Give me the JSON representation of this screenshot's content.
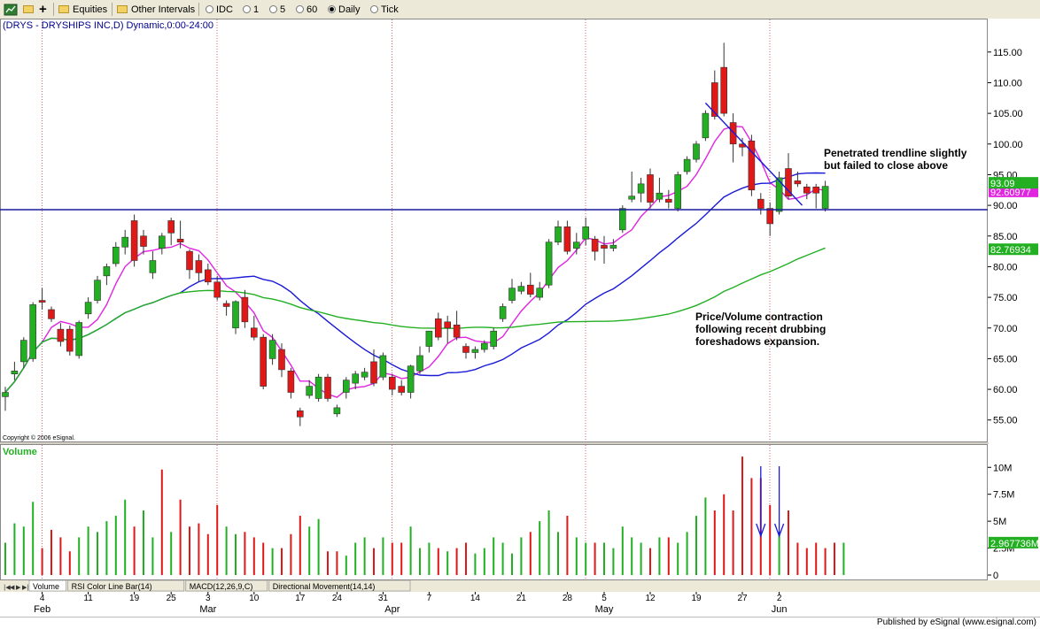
{
  "toolbar": {
    "equities_label": "Equities",
    "other_intervals_label": "Other Intervals",
    "options": [
      {
        "label": "IDC",
        "selected": false
      },
      {
        "label": "1",
        "selected": false
      },
      {
        "label": "5",
        "selected": false
      },
      {
        "label": "60",
        "selected": false
      },
      {
        "label": "Daily",
        "selected": true
      },
      {
        "label": "Tick",
        "selected": false
      }
    ]
  },
  "tabs": [
    {
      "label": "Volume",
      "active": true
    },
    {
      "label": "RSI Color Line Bar(14)",
      "active": false
    },
    {
      "label": "MACD(12,26,9,C)",
      "active": false
    },
    {
      "label": "Directional Movement(14,14)",
      "active": false
    }
  ],
  "footer": {
    "published": "Published by eSignal (www.esignal.com)"
  },
  "chart_data": {
    "type": "candlestick",
    "title": "(DRYS - DRYSHIPS INC,D) Dynamic,0:00-24:00",
    "copyright": "Copyright © 2006 eSignal.",
    "volume_label": "Volume",
    "price_axis": {
      "ticks": [
        "115.00",
        "110.00",
        "105.00",
        "100.00",
        "95.00",
        "90.00",
        "85.00",
        "80.00",
        "75.00",
        "70.00",
        "65.00",
        "60.00",
        "55.00"
      ],
      "ylim": [
        51.5,
        118
      ]
    },
    "volume_axis": {
      "ticks": [
        "10M",
        "7.5M",
        "5M",
        "2.5M",
        "0"
      ],
      "ylim": [
        0,
        11.5
      ]
    },
    "price_labels": {
      "last": "93.09",
      "ma_fast": "92.60977",
      "ma_slow": "82.76934"
    },
    "volume_last_label": "2.967736M",
    "x_axis": {
      "day_ticks": [
        [
          "4",
          4
        ],
        [
          "11",
          9
        ],
        [
          "19",
          14
        ],
        [
          "25",
          18
        ],
        [
          "3",
          22
        ],
        [
          "10",
          27
        ],
        [
          "17",
          32
        ],
        [
          "24",
          36
        ],
        [
          "31",
          41
        ],
        [
          "7",
          46
        ],
        [
          "14",
          51
        ],
        [
          "21",
          56
        ],
        [
          "28",
          61
        ],
        [
          "5",
          65
        ],
        [
          "12",
          70
        ],
        [
          "19",
          75
        ],
        [
          "27",
          80
        ],
        [
          "2",
          84
        ],
        [
          "Jun",
          85
        ]
      ],
      "month_labels": [
        [
          "Feb",
          4
        ],
        [
          "Mar",
          22
        ],
        [
          "Apr",
          42
        ],
        [
          "May",
          65
        ],
        [
          "Jun",
          84
        ]
      ],
      "month_dividers": [
        4,
        23,
        42,
        63,
        83
      ]
    },
    "horizontal_line": 89.3,
    "trendline": {
      "from": [
        76,
        106.7
      ],
      "to": [
        86.5,
        90
      ]
    },
    "annotations": [
      "Penetrated trendline slightly but failed to close above",
      "Price/Volume contraction following recent drubbing foreshadows expansion."
    ],
    "arrows_at": [
      82,
      84
    ],
    "candles": [
      {
        "o": 58.8,
        "h": 60.4,
        "l": 56.5,
        "c": 59.5
      },
      {
        "o": 62.5,
        "h": 64.5,
        "l": 61.5,
        "c": 63.0
      },
      {
        "o": 64.5,
        "h": 68.5,
        "l": 63.5,
        "c": 68.0
      },
      {
        "o": 65.0,
        "h": 74.2,
        "l": 64.5,
        "c": 73.8
      },
      {
        "o": 74.5,
        "h": 76.5,
        "l": 73.0,
        "c": 74.2
      },
      {
        "o": 73.0,
        "h": 73.5,
        "l": 71.0,
        "c": 71.5
      },
      {
        "o": 69.8,
        "h": 70.8,
        "l": 67.0,
        "c": 67.8
      },
      {
        "o": 69.8,
        "h": 70.4,
        "l": 65.5,
        "c": 66.2
      },
      {
        "o": 65.5,
        "h": 71.2,
        "l": 65.0,
        "c": 70.9
      },
      {
        "o": 72.3,
        "h": 75.0,
        "l": 71.5,
        "c": 74.2
      },
      {
        "o": 74.5,
        "h": 78.5,
        "l": 74.0,
        "c": 77.8
      },
      {
        "o": 78.5,
        "h": 80.5,
        "l": 77.0,
        "c": 80.0
      },
      {
        "o": 80.5,
        "h": 84.0,
        "l": 80.0,
        "c": 83.2
      },
      {
        "o": 83.2,
        "h": 86.0,
        "l": 82.0,
        "c": 84.8
      },
      {
        "o": 87.5,
        "h": 88.5,
        "l": 80.0,
        "c": 81.0
      },
      {
        "o": 85.0,
        "h": 86.0,
        "l": 82.0,
        "c": 83.3
      },
      {
        "o": 79.0,
        "h": 82.5,
        "l": 78.0,
        "c": 81.0
      },
      {
        "o": 83.0,
        "h": 85.5,
        "l": 82.0,
        "c": 85.0
      },
      {
        "o": 87.5,
        "h": 88.0,
        "l": 83.5,
        "c": 85.5
      },
      {
        "o": 84.5,
        "h": 87.5,
        "l": 83.0,
        "c": 84.0
      },
      {
        "o": 82.5,
        "h": 82.8,
        "l": 78.0,
        "c": 79.5
      },
      {
        "o": 81.0,
        "h": 82.0,
        "l": 77.5,
        "c": 79.0
      },
      {
        "o": 79.5,
        "h": 80.5,
        "l": 77.0,
        "c": 77.5
      },
      {
        "o": 77.5,
        "h": 78.5,
        "l": 74.5,
        "c": 75.0
      },
      {
        "o": 74.0,
        "h": 74.5,
        "l": 72.0,
        "c": 73.5
      },
      {
        "o": 70.0,
        "h": 74.5,
        "l": 69.0,
        "c": 74.3
      },
      {
        "o": 75.0,
        "h": 76.2,
        "l": 70.0,
        "c": 71.0
      },
      {
        "o": 70.0,
        "h": 72.0,
        "l": 68.0,
        "c": 68.5
      },
      {
        "o": 68.5,
        "h": 69.0,
        "l": 60.0,
        "c": 60.5
      },
      {
        "o": 65.0,
        "h": 69.0,
        "l": 64.0,
        "c": 68.0
      },
      {
        "o": 66.5,
        "h": 67.5,
        "l": 62.0,
        "c": 63.2
      },
      {
        "o": 63.0,
        "h": 63.5,
        "l": 58.5,
        "c": 59.5
      },
      {
        "o": 56.5,
        "h": 57.0,
        "l": 54.0,
        "c": 55.5
      },
      {
        "o": 59.0,
        "h": 61.5,
        "l": 58.5,
        "c": 60.5
      },
      {
        "o": 58.5,
        "h": 62.5,
        "l": 58.0,
        "c": 62.0
      },
      {
        "o": 62.0,
        "h": 62.5,
        "l": 58.0,
        "c": 58.5
      },
      {
        "o": 56.0,
        "h": 57.5,
        "l": 55.5,
        "c": 57.0
      },
      {
        "o": 59.5,
        "h": 62.0,
        "l": 58.5,
        "c": 61.5
      },
      {
        "o": 61.0,
        "h": 63.0,
        "l": 60.0,
        "c": 62.5
      },
      {
        "o": 62.0,
        "h": 63.5,
        "l": 61.5,
        "c": 62.8
      },
      {
        "o": 64.5,
        "h": 66.5,
        "l": 60.5,
        "c": 61.0
      },
      {
        "o": 62.0,
        "h": 66.0,
        "l": 61.5,
        "c": 65.5
      },
      {
        "o": 62.0,
        "h": 62.5,
        "l": 59.0,
        "c": 60.0
      },
      {
        "o": 60.5,
        "h": 61.5,
        "l": 59.0,
        "c": 59.5
      },
      {
        "o": 59.5,
        "h": 64.0,
        "l": 58.5,
        "c": 63.8
      },
      {
        "o": 63.0,
        "h": 67.0,
        "l": 62.5,
        "c": 65.5
      },
      {
        "o": 67.0,
        "h": 69.5,
        "l": 66.0,
        "c": 69.5
      },
      {
        "o": 71.5,
        "h": 72.5,
        "l": 68.0,
        "c": 68.5
      },
      {
        "o": 71.0,
        "h": 72.0,
        "l": 67.5,
        "c": 70.0
      },
      {
        "o": 70.5,
        "h": 72.8,
        "l": 68.0,
        "c": 68.5
      },
      {
        "o": 67.0,
        "h": 67.5,
        "l": 65.0,
        "c": 66.0
      },
      {
        "o": 66.0,
        "h": 67.0,
        "l": 65.0,
        "c": 66.5
      },
      {
        "o": 66.5,
        "h": 68.0,
        "l": 66.0,
        "c": 67.5
      },
      {
        "o": 67.0,
        "h": 70.0,
        "l": 66.5,
        "c": 69.5
      },
      {
        "o": 71.5,
        "h": 74.0,
        "l": 71.0,
        "c": 73.5
      },
      {
        "o": 74.5,
        "h": 78.0,
        "l": 74.0,
        "c": 76.5
      },
      {
        "o": 76.0,
        "h": 77.5,
        "l": 75.5,
        "c": 76.8
      },
      {
        "o": 77.0,
        "h": 79.0,
        "l": 75.0,
        "c": 75.5
      },
      {
        "o": 75.0,
        "h": 77.5,
        "l": 74.5,
        "c": 76.5
      },
      {
        "o": 77.0,
        "h": 84.5,
        "l": 76.5,
        "c": 84.0
      },
      {
        "o": 84.0,
        "h": 87.5,
        "l": 83.5,
        "c": 86.5
      },
      {
        "o": 86.5,
        "h": 87.5,
        "l": 82.0,
        "c": 82.5
      },
      {
        "o": 83.0,
        "h": 85.5,
        "l": 82.0,
        "c": 84.0
      },
      {
        "o": 84.5,
        "h": 88.0,
        "l": 83.5,
        "c": 86.5
      },
      {
        "o": 84.5,
        "h": 85.0,
        "l": 81.0,
        "c": 82.5
      },
      {
        "o": 83.5,
        "h": 85.0,
        "l": 80.5,
        "c": 83.0
      },
      {
        "o": 83.0,
        "h": 84.5,
        "l": 82.5,
        "c": 83.5
      },
      {
        "o": 86.0,
        "h": 90.0,
        "l": 85.5,
        "c": 89.5
      },
      {
        "o": 91.0,
        "h": 95.5,
        "l": 90.5,
        "c": 91.5
      },
      {
        "o": 92.0,
        "h": 94.5,
        "l": 90.5,
        "c": 93.5
      },
      {
        "o": 95.0,
        "h": 96.0,
        "l": 89.5,
        "c": 90.5
      },
      {
        "o": 91.0,
        "h": 94.5,
        "l": 90.5,
        "c": 92.0
      },
      {
        "o": 91.0,
        "h": 92.5,
        "l": 89.5,
        "c": 90.5
      },
      {
        "o": 89.5,
        "h": 95.5,
        "l": 89.0,
        "c": 95.0
      },
      {
        "o": 95.5,
        "h": 98.0,
        "l": 95.0,
        "c": 97.5
      },
      {
        "o": 97.5,
        "h": 100.5,
        "l": 97.0,
        "c": 100.0
      },
      {
        "o": 101.0,
        "h": 105.5,
        "l": 100.5,
        "c": 105.0
      },
      {
        "o": 110.0,
        "h": 112.0,
        "l": 104.0,
        "c": 104.5
      },
      {
        "o": 112.5,
        "h": 116.5,
        "l": 104.5,
        "c": 105.0
      },
      {
        "o": 103.5,
        "h": 105.0,
        "l": 97.0,
        "c": 100.0
      },
      {
        "o": 100.0,
        "h": 101.0,
        "l": 98.0,
        "c": 99.5
      },
      {
        "o": 100.5,
        "h": 101.5,
        "l": 91.5,
        "c": 92.5
      },
      {
        "o": 91.0,
        "h": 92.0,
        "l": 88.5,
        "c": 89.5
      },
      {
        "o": 89.5,
        "h": 90.5,
        "l": 85.0,
        "c": 87.0
      },
      {
        "o": 89.0,
        "h": 95.5,
        "l": 88.5,
        "c": 94.5
      },
      {
        "o": 96.0,
        "h": 98.5,
        "l": 91.0,
        "c": 91.5
      },
      {
        "o": 94.0,
        "h": 95.5,
        "l": 93.0,
        "c": 93.5
      },
      {
        "o": 93.0,
        "h": 93.5,
        "l": 91.0,
        "c": 92.0
      },
      {
        "o": 93.0,
        "h": 93.5,
        "l": 89.5,
        "c": 92.0
      },
      {
        "o": 89.5,
        "h": 94.0,
        "l": 89.0,
        "c": 93.1
      }
    ],
    "volumes": [
      3.0,
      4.8,
      4.5,
      6.8,
      2.5,
      4.2,
      3.5,
      2.2,
      3.5,
      4.5,
      4.0,
      5.0,
      5.5,
      7.0,
      4.5,
      6.0,
      3.5,
      9.8,
      4.0,
      7.0,
      4.5,
      4.8,
      3.8,
      6.5,
      4.5,
      3.8,
      4.0,
      3.5,
      3.0,
      2.5,
      2.5,
      3.8,
      5.5,
      4.5,
      5.2,
      2.2,
      2.2,
      1.8,
      3.0,
      3.5,
      2.5,
      3.5,
      3.0,
      3.0,
      4.5,
      2.5,
      3.0,
      2.5,
      2.2,
      2.5,
      3.0,
      2.0,
      2.5,
      3.5,
      3.0,
      2.0,
      3.5,
      4.0,
      5.0,
      6.0,
      4.0,
      5.5,
      3.5,
      3.0,
      3.0,
      3.0,
      2.5,
      4.5,
      3.5,
      3.0,
      2.5,
      3.5,
      3.5,
      3.0,
      4.0,
      5.5,
      7.2,
      6.0,
      7.5,
      6.0,
      11.0,
      9.0,
      9.0,
      6.5,
      4.0,
      6.0,
      3.0,
      2.5,
      3.0,
      2.5,
      3.0,
      3.0
    ],
    "volume_up": [
      1,
      1,
      1,
      1,
      0,
      0,
      0,
      0,
      1,
      1,
      1,
      1,
      1,
      1,
      0,
      1,
      1,
      0,
      1,
      0,
      0,
      0,
      0,
      0,
      1,
      1,
      0,
      0,
      0,
      1,
      0,
      0,
      0,
      1,
      1,
      0,
      0,
      1,
      1,
      1,
      0,
      1,
      0,
      0,
      1,
      1,
      1,
      0,
      1,
      0,
      0,
      1,
      1,
      1,
      1,
      1,
      1,
      0,
      1,
      1,
      1,
      0,
      1,
      1,
      0,
      1,
      1,
      1,
      1,
      1,
      0,
      1,
      0,
      1,
      1,
      1,
      1,
      0,
      0,
      0,
      0,
      0,
      0,
      0,
      1,
      0,
      0,
      0,
      0,
      0,
      0,
      1
    ]
  }
}
